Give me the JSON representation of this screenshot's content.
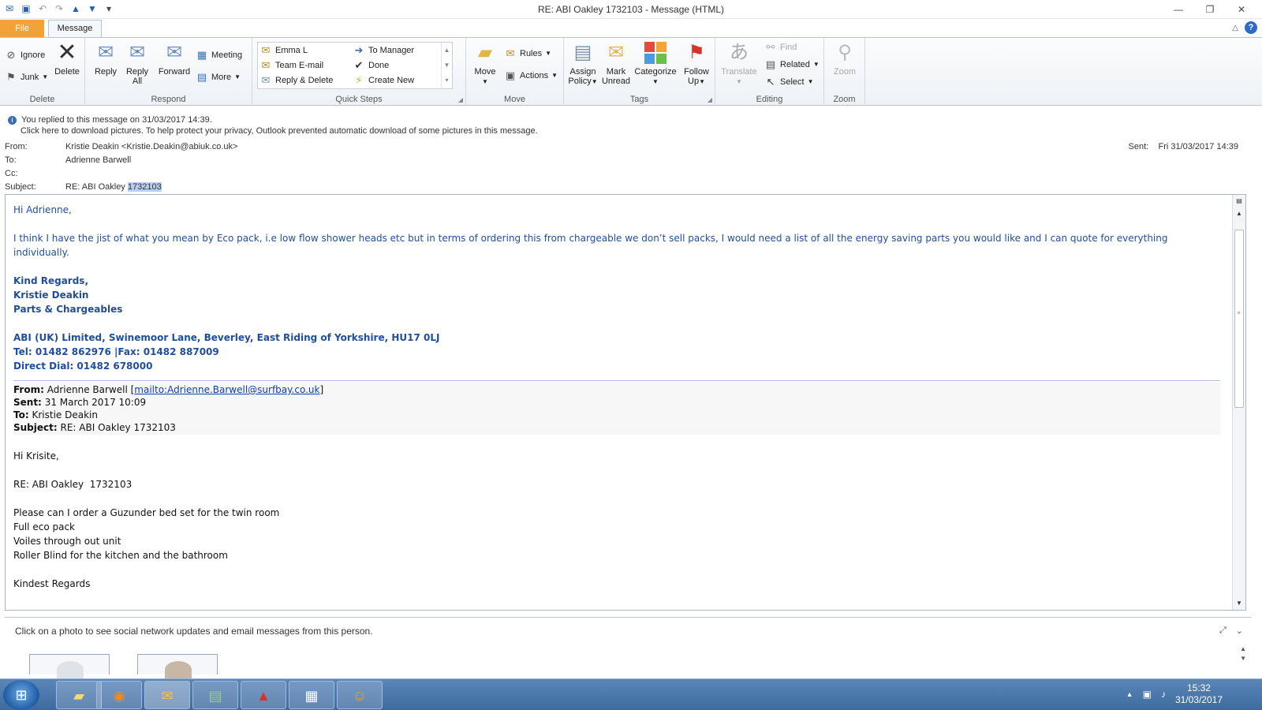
{
  "window": {
    "title": "RE: ABI Oakley  1732103  - Message (HTML)"
  },
  "tabs": {
    "file": "File",
    "message": "Message"
  },
  "ribbon": {
    "delete_group": {
      "label": "Delete",
      "ignore": "Ignore",
      "junk": "Junk",
      "delete": "Delete"
    },
    "respond_group": {
      "label": "Respond",
      "reply": "Reply",
      "reply_all_1": "Reply",
      "reply_all_2": "All",
      "forward": "Forward",
      "meeting": "Meeting",
      "more": "More"
    },
    "quick_steps": {
      "label": "Quick Steps",
      "emma": "Emma L",
      "team_email": "Team E-mail",
      "reply_delete": "Reply & Delete",
      "to_manager": "To Manager",
      "done": "Done",
      "create_new": "Create New"
    },
    "move_group": {
      "label": "Move",
      "move": "Move",
      "rules": "Rules",
      "actions": "Actions"
    },
    "tags_group": {
      "label": "Tags",
      "assign_1": "Assign",
      "assign_2": "Policy",
      "mark_1": "Mark",
      "mark_2": "Unread",
      "categorize": "Categorize",
      "follow_1": "Follow",
      "follow_2": "Up"
    },
    "editing_group": {
      "label": "Editing",
      "translate": "Translate",
      "find": "Find",
      "related": "Related",
      "select": "Select"
    },
    "zoom_group": {
      "label": "Zoom",
      "zoom": "Zoom"
    }
  },
  "header": {
    "info_line1": "You replied to this message on 31/03/2017 14:39.",
    "info_line2": "Click here to download pictures. To help protect your privacy, Outlook prevented automatic download of some pictures in this message.",
    "from_label": "From:",
    "from_value": "Kristie Deakin <Kristie.Deakin@abiuk.co.uk>",
    "to_label": "To:",
    "to_value": "Adrienne Barwell",
    "cc_label": "Cc:",
    "subject_label": "Subject:",
    "subject_prefix": "RE: ABI Oakley ",
    "subject_highlight": "1732103",
    "sent_label": "Sent:",
    "sent_value": "Fri 31/03/2017 14:39"
  },
  "body": {
    "greeting": "Hi Adrienne,",
    "paragraph": "I think I have the jist of what you mean by Eco pack, i.e low flow shower heads etc but in terms of ordering this from chargeable we don’t sell packs, I would need a list of all the energy saving parts you would like and I can quote for everything individually.",
    "sig_regards": "Kind Regards,",
    "sig_name": "Kristie Deakin",
    "sig_dept": "Parts & Chargeables",
    "sig_address": "ABI (UK) Limited, Swinemoor Lane, Beverley, East Riding of Yorkshire, HU17 0LJ",
    "sig_tel": "Tel: 01482 862976 |Fax: 01482 887009",
    "sig_direct": "Direct Dial: 01482 678000",
    "q_from_label": "From:",
    "q_from_value": "Adrienne Barwell [",
    "q_from_link": "mailto:Adrienne.Barwell@surfbay.co.uk",
    "q_from_end": "]",
    "q_sent_label": "Sent:",
    "q_sent_value": "31 March 2017 10:09",
    "q_to_label": "To:",
    "q_to_value": "Kristie Deakin",
    "q_subject_label": "Subject:",
    "q_subject_value": "RE: ABI Oakley 1732103",
    "q_greeting": "Hi Krisite,",
    "q_ref": "RE: ABI Oakley  1732103",
    "q_line1": "Please can I order a Guzunder bed set for the twin room",
    "q_line2": "Full eco pack",
    "q_line3": "Voiles through out unit",
    "q_line4": "Roller Blind for the kitchen and the bathroom",
    "q_closing": "Kindest Regards"
  },
  "people_pane": {
    "message": "Click on a photo to see social network updates and email messages from this person."
  },
  "taskbar": {
    "time": "15:32",
    "date": "31/03/2017"
  }
}
